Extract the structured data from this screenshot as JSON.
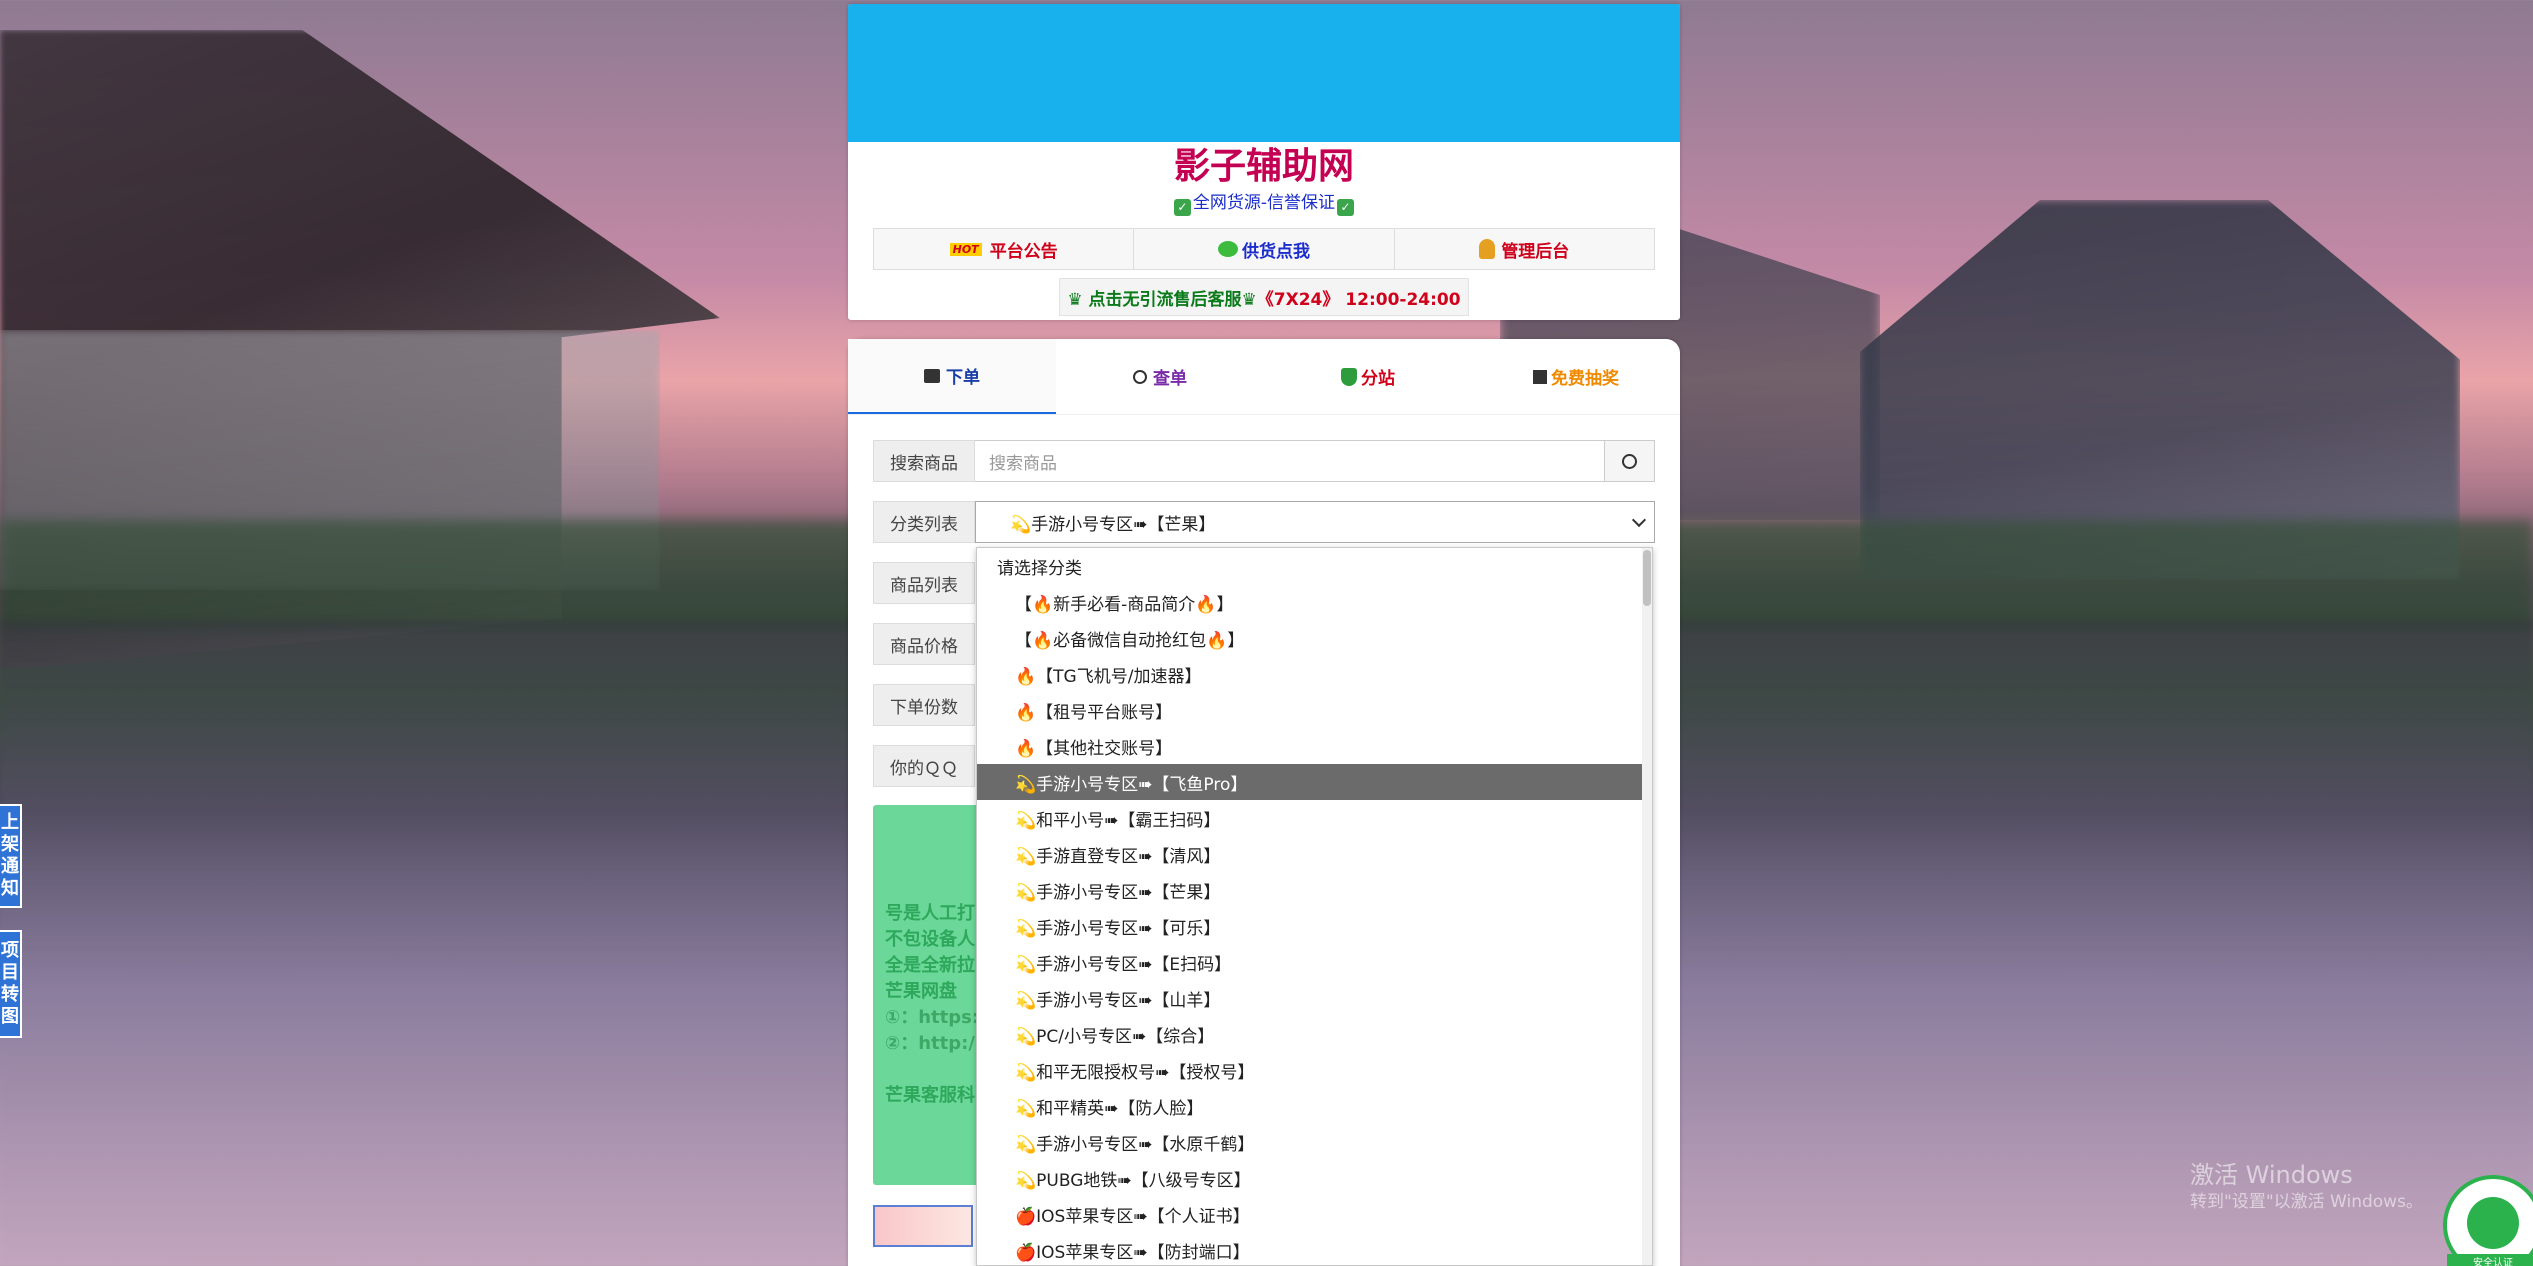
{
  "site": {
    "title": "影子辅助网",
    "subtitle": "全网货源-信誉保证",
    "nav": [
      {
        "label": "平台公告",
        "color": "#d0021b",
        "icon": "hot-badge-icon"
      },
      {
        "label": "供货点我",
        "color": "#1a2ccb",
        "icon": "chat-icon"
      },
      {
        "label": "管理后台",
        "color": "#d0021b",
        "icon": "user-icon"
      }
    ],
    "hot_badge": "HOT",
    "sale_text_a": "♛ 点击无引流售后客服♛",
    "sale_text_b": " 《7X24》 12:00-24:00"
  },
  "tabs": [
    {
      "label": "下单",
      "color": "#1a6be0",
      "icon": "bag-icon"
    },
    {
      "label": "查单",
      "color": "#7a2aa8",
      "icon": "search-icon"
    },
    {
      "label": "分站",
      "color": "#d0021b",
      "icon": "shield-icon"
    },
    {
      "label": "免费抽奖",
      "color": "#f08a00",
      "icon": "gift-icon"
    }
  ],
  "form": {
    "search_label": "搜索商品",
    "search_placeholder": "搜索商品",
    "category_label": "分类列表",
    "category_value": "💫手游小号专区➠【芒果】",
    "product_label": "商品列表",
    "price_label": "商品价格",
    "qty_label": "下单份数",
    "qq_label": "你的ＱＱ"
  },
  "notice_lines": [
    "号是人工打",
    "不包设备人",
    "全是全新拉",
    "芒果网盘",
    "①：https:",
    "②：http:/",
    "",
    "芒果客服科"
  ],
  "dropdown": {
    "items": [
      {
        "text": "请选择分类",
        "indent": false
      },
      {
        "text": "【🔥新手必看-商品简介🔥】",
        "indent": true
      },
      {
        "text": "【🔥必备微信自动抢红包🔥】",
        "indent": true
      },
      {
        "text": "🔥【TG飞机号/加速器】",
        "indent": true
      },
      {
        "text": "🔥【租号平台账号】",
        "indent": true
      },
      {
        "text": "🔥【其他社交账号】",
        "indent": true
      },
      {
        "text": "💫手游小号专区➠【飞鱼Pro】",
        "indent": true,
        "highlight": true
      },
      {
        "text": "💫和平小号➠【霸王扫码】",
        "indent": true
      },
      {
        "text": "💫手游直登专区➠【清风】",
        "indent": true
      },
      {
        "text": "💫手游小号专区➠【芒果】",
        "indent": true
      },
      {
        "text": "💫手游小号专区➠【可乐】",
        "indent": true
      },
      {
        "text": "💫手游小号专区➠【E扫码】",
        "indent": true
      },
      {
        "text": "💫手游小号专区➠【山羊】",
        "indent": true
      },
      {
        "text": "💫PC/小号专区➠【综合】",
        "indent": true
      },
      {
        "text": "💫和平无限授权号➠【授权号】",
        "indent": true
      },
      {
        "text": "💫和平精英➠【防人脸】",
        "indent": true
      },
      {
        "text": "💫手游小号专区➠【水原千鹤】",
        "indent": true
      },
      {
        "text": "💫PUBG地铁➠【八级号专区】",
        "indent": true
      },
      {
        "text": "🍎IOS苹果专区➠【个人证书】",
        "indent": true
      },
      {
        "text": "🍎IOS苹果专区➠【防封端口】",
        "indent": true
      }
    ]
  },
  "side_tabs": [
    {
      "text": "上架通知"
    },
    {
      "text": "项目转图"
    }
  ],
  "watermark": {
    "line1": "激活 Windows",
    "line2": "转到\"设置\"以激活 Windows。"
  },
  "badge_text": "安全认证"
}
